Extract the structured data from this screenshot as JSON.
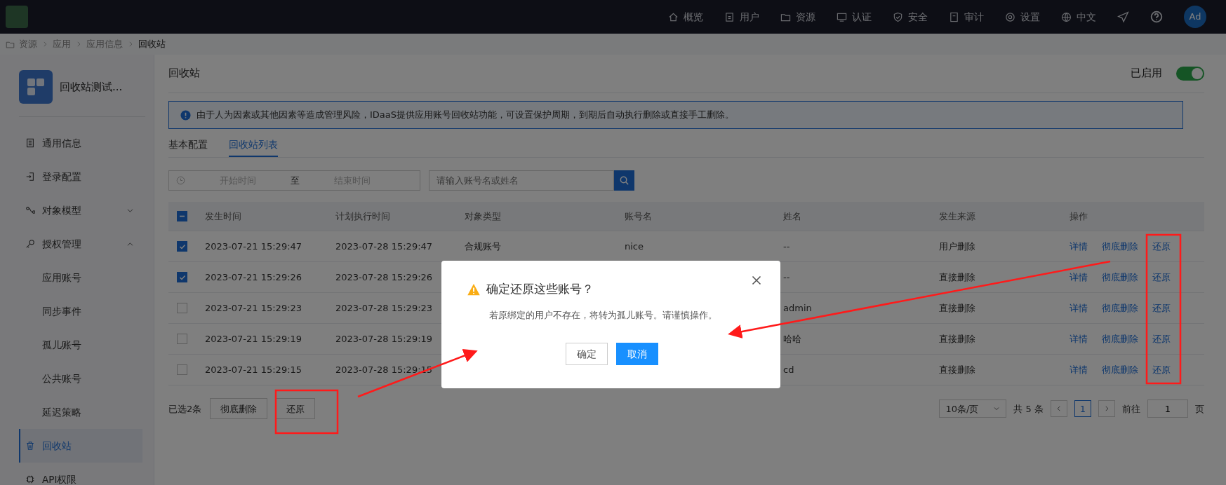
{
  "topbar": {
    "nav": [
      {
        "label": "概览"
      },
      {
        "label": "用户"
      },
      {
        "label": "资源"
      },
      {
        "label": "认证"
      },
      {
        "label": "安全"
      },
      {
        "label": "审计"
      },
      {
        "label": "设置"
      },
      {
        "label": "中文"
      }
    ],
    "avatar": "Ad"
  },
  "breadcrumb": [
    "资源",
    "应用",
    "应用信息",
    "回收站"
  ],
  "sidebar": {
    "app_name": "回收站测试...",
    "items": [
      {
        "label": "通用信息",
        "selected": false
      },
      {
        "label": "登录配置",
        "selected": false
      },
      {
        "label": "对象模型",
        "selected": false,
        "expanded": false
      },
      {
        "label": "授权管理",
        "selected": false,
        "expanded": true,
        "children": [
          {
            "label": "应用账号",
            "selected": false
          },
          {
            "label": "同步事件",
            "selected": false
          },
          {
            "label": "孤儿账号",
            "selected": false
          },
          {
            "label": "公共账号",
            "selected": false
          },
          {
            "label": "延迟策略",
            "selected": false
          }
        ]
      },
      {
        "label": "回收站",
        "selected": true
      },
      {
        "label": "API权限",
        "selected": false
      }
    ]
  },
  "page": {
    "title": "回收站",
    "status_label": "已启用",
    "enabled": true
  },
  "notice": "由于人为因素或其他因素等造成管理风险，IDaaS提供应用账号回收站功能，可设置保护周期，到期后自动执行删除或直接手工删除。",
  "tabs": [
    {
      "label": "基本配置",
      "selected": false
    },
    {
      "label": "回收站列表",
      "selected": true
    }
  ],
  "filters": {
    "start_placeholder": "开始时间",
    "separator": "至",
    "end_placeholder": "结束时间",
    "search_placeholder": "请输入账号名或姓名"
  },
  "table": {
    "header_indeterminate": true,
    "columns": [
      "发生时间",
      "计划执行时间",
      "对象类型",
      "账号名",
      "姓名",
      "发生来源",
      "操作"
    ],
    "rows": [
      {
        "checked": true,
        "occurred": "2023-07-21 15:29:47",
        "scheduled": "2023-07-28 15:29:47",
        "object_type": "合规账号",
        "account": "nice",
        "name": "--",
        "source": "用户删除",
        "actions": [
          "详情",
          "彻底删除",
          "还原"
        ]
      },
      {
        "checked": true,
        "occurred": "2023-07-21 15:29:26",
        "scheduled": "2023-07-28 15:29:26",
        "name": "--",
        "source": "直接删除",
        "actions": [
          "详情",
          "彻底删除",
          "还原"
        ]
      },
      {
        "checked": false,
        "occurred": "2023-07-21 15:29:23",
        "scheduled": "2023-07-28 15:29:23",
        "name": "admin",
        "source": "直接删除",
        "actions": [
          "详情",
          "彻底删除",
          "还原"
        ]
      },
      {
        "checked": false,
        "occurred": "2023-07-21 15:29:19",
        "scheduled": "2023-07-28 15:29:19",
        "name": "哈哈",
        "source": "直接删除",
        "actions": [
          "详情",
          "彻底删除",
          "还原"
        ]
      },
      {
        "checked": false,
        "occurred": "2023-07-21 15:29:15",
        "scheduled": "2023-07-28 15:29:15",
        "name": "cd",
        "source": "直接删除",
        "actions": [
          "详情",
          "彻底删除",
          "还原"
        ]
      }
    ]
  },
  "footer": {
    "selected_count": "已选2条",
    "buttons": [
      "彻底删除",
      "还原"
    ],
    "page_size": "10条/页",
    "total": "共 5 条",
    "pages": [
      {
        "label": "1",
        "selected": true
      }
    ],
    "goto_label": "前往",
    "goto_value": "1",
    "page_unit": "页"
  },
  "dialog": {
    "title": "确定还原这些账号？",
    "message": "若原绑定的用户不存在，将转为孤儿账号。请谨慎操作。",
    "buttons": [
      {
        "label": "确定",
        "kind": "default"
      },
      {
        "label": "取消",
        "kind": "primary"
      }
    ]
  }
}
